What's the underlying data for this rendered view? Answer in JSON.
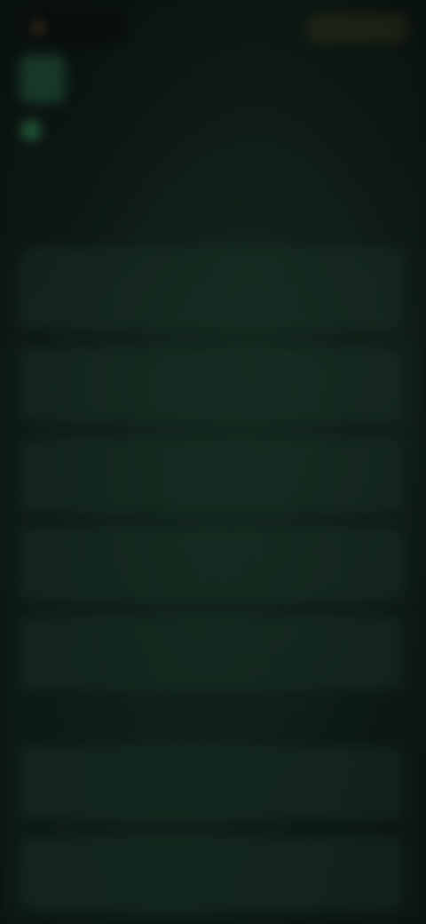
{
  "topbar": {
    "brand": "",
    "action": ""
  },
  "header": {
    "title": "",
    "subtitle": ""
  },
  "sections": [
    {
      "label": "",
      "cards": [
        {
          "title": "",
          "desc": ""
        },
        {
          "title": "",
          "desc": ""
        },
        {
          "title": "",
          "desc": ""
        },
        {
          "title": "",
          "desc": ""
        },
        {
          "title": "",
          "desc": ""
        }
      ]
    },
    {
      "label": "",
      "cards": [
        {
          "title": "",
          "desc": ""
        },
        {
          "title": "",
          "desc": ""
        }
      ]
    }
  ],
  "colors": {
    "background": "#0e1a15",
    "card": "#1f3a2d",
    "accent": "#2a6a45",
    "action": "#b7a860"
  },
  "icons": {
    "brand": "brand-logo-icon",
    "header": "category-icon",
    "avatar": "avatar-icon"
  }
}
